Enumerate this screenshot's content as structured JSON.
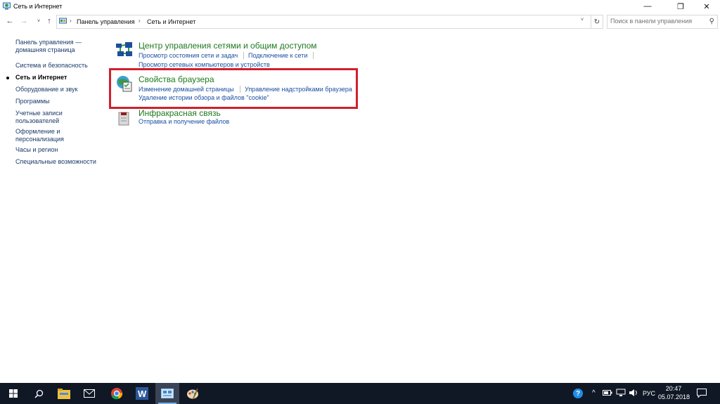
{
  "window": {
    "title": "Сеть и Интернет",
    "minimize_symbol": "—",
    "maximize_symbol": "❐",
    "close_symbol": "✕"
  },
  "navigation": {
    "back_symbol": "←",
    "forward_symbol": "→",
    "recent_symbol": "˅",
    "up_symbol": "↑",
    "breadcrumbs": [
      "Панель управления",
      "Сеть и Интернет"
    ],
    "crumb_separator": "›",
    "refresh_symbol": "↻",
    "search_placeholder": "Поиск в панели управления",
    "search_symbol": "⚲"
  },
  "sidebar": {
    "home": "Панель управления — домашняя страница",
    "items": [
      {
        "label": "Система и безопасность",
        "current": false
      },
      {
        "label": "Сеть и Интернет",
        "current": true
      },
      {
        "label": "Оборудование и звук",
        "current": false
      },
      {
        "label": "Программы",
        "current": false
      },
      {
        "label": "Учетные записи пользователей",
        "current": false
      },
      {
        "label": "Оформление и персонализация",
        "current": false
      },
      {
        "label": "Часы и регион",
        "current": false
      },
      {
        "label": "Специальные возможности",
        "current": false
      }
    ]
  },
  "categories": [
    {
      "icon": "network-center-icon",
      "title": "Центр управления сетями и общим доступом",
      "links": [
        "Просмотр состояния сети и задач",
        "Подключение к сети",
        "Просмотр сетевых компьютеров и устройств"
      ]
    },
    {
      "icon": "browser-properties-icon",
      "title": "Свойства браузера",
      "links": [
        "Изменение домашней страницы",
        "Управление надстройками браузера",
        "Удаление истории обзора и файлов \"cookie\""
      ],
      "highlighted": true
    },
    {
      "icon": "infrared-icon",
      "title": "Инфракрасная связь",
      "links": [
        "Отправка и получение файлов"
      ]
    }
  ],
  "taskbar": {
    "apps": [
      "windows-start-icon",
      "search-icon",
      "file-explorer-icon",
      "mail-icon",
      "chrome-icon",
      "word-icon",
      "control-panel-icon",
      "paint-icon"
    ],
    "active_app": "control-panel-icon",
    "tray": {
      "language": "РУС",
      "time": "20:47",
      "date": "05.07.2018",
      "help_symbol": "?",
      "chevron_symbol": "^"
    }
  },
  "colors": {
    "highlight_border": "#d0202e",
    "category_title": "#1e7a1e",
    "link": "#1a4fa0",
    "taskbar_bg": "#101826"
  }
}
